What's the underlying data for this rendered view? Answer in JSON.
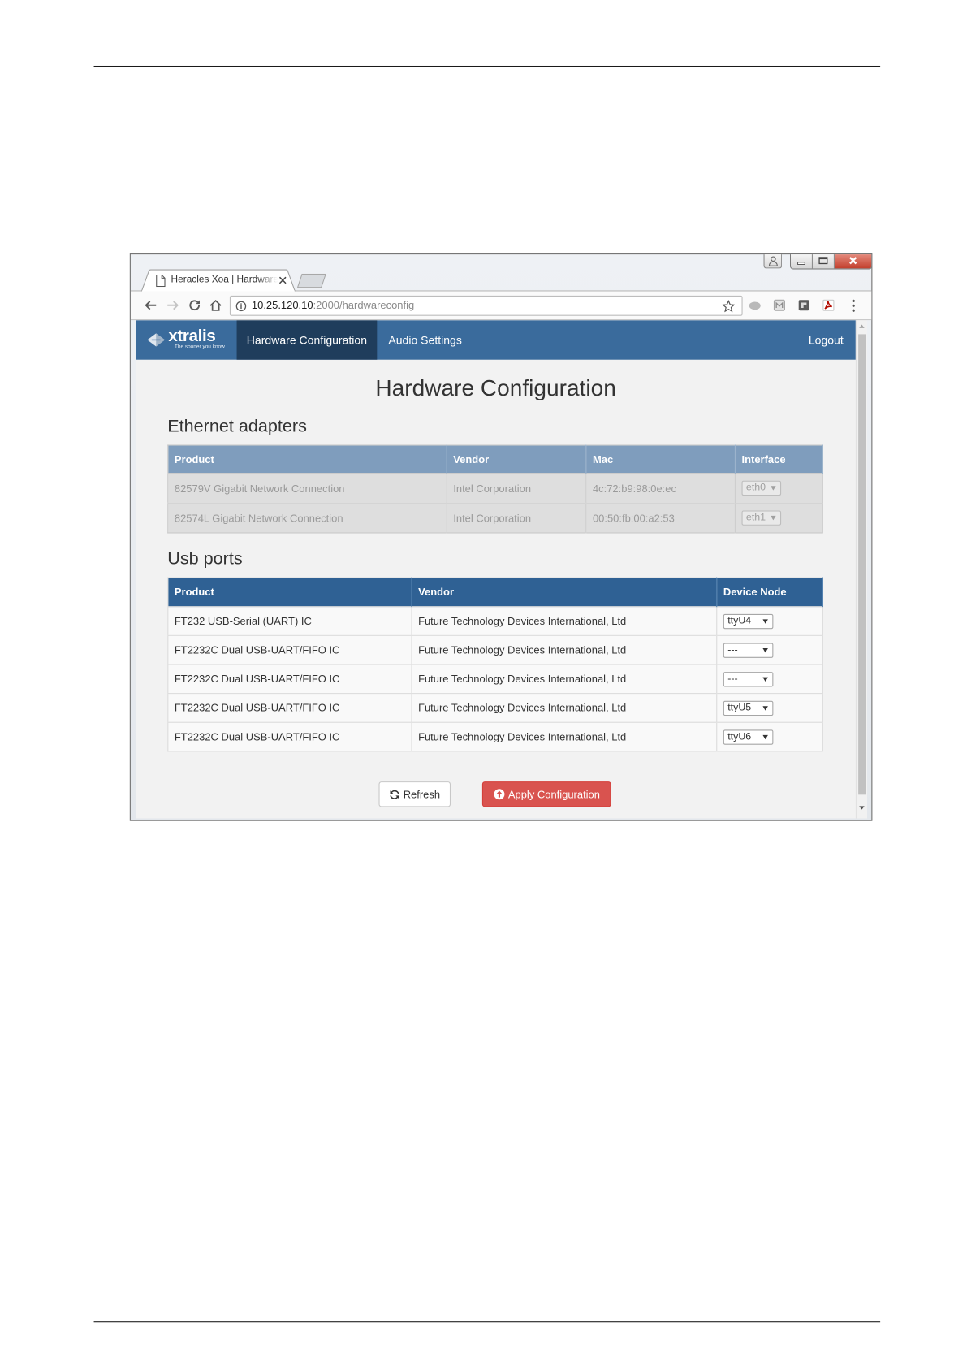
{
  "browser": {
    "tab_title": "Heracles Xoa | Hardware",
    "url_host": "10.25.120.10",
    "url_path": ":2000/hardwareconfig",
    "icons": [
      "user-icon",
      "minimize-icon",
      "maximize-icon",
      "close-icon",
      "page-icon",
      "tab-close-icon",
      "back-arrow-icon",
      "forward-arrow-icon",
      "reload-icon",
      "home-icon",
      "info-icon",
      "star-icon",
      "extension-gray-icon",
      "extension-box-icon",
      "extension-dark-icon",
      "acrobat-pdf-icon",
      "menu-dots-icon"
    ]
  },
  "navbar": {
    "logo_text": "xtralis",
    "logo_tagline": "The sooner you know",
    "items": [
      {
        "label": "Hardware Configuration",
        "active": true
      },
      {
        "label": "Audio Settings",
        "active": false
      }
    ],
    "logout_label": "Logout"
  },
  "page": {
    "title": "Hardware Configuration"
  },
  "ethernet": {
    "heading": "Ethernet adapters",
    "disabled": true,
    "columns": {
      "product": "Product",
      "vendor": "Vendor",
      "mac": "Mac",
      "interface": "Interface"
    },
    "rows": [
      {
        "product": "82579V Gigabit Network Connection",
        "vendor": "Intel Corporation",
        "mac": "4c:72:b9:98:0e:ec",
        "interface": "eth0"
      },
      {
        "product": "82574L Gigabit Network Connection",
        "vendor": "Intel Corporation",
        "mac": "00:50:fb:00:a2:53",
        "interface": "eth1"
      }
    ]
  },
  "usb": {
    "heading": "Usb ports",
    "columns": {
      "product": "Product",
      "vendor": "Vendor",
      "device_node": "Device Node"
    },
    "rows": [
      {
        "product": "FT232 USB-Serial (UART) IC",
        "vendor": "Future Technology Devices International, Ltd",
        "device_node": "ttyU4"
      },
      {
        "product": "FT2232C Dual USB-UART/FIFO IC",
        "vendor": "Future Technology Devices International, Ltd",
        "device_node": "---"
      },
      {
        "product": "FT2232C Dual USB-UART/FIFO IC",
        "vendor": "Future Technology Devices International, Ltd",
        "device_node": "---"
      },
      {
        "product": "FT2232C Dual USB-UART/FIFO IC",
        "vendor": "Future Technology Devices International, Ltd",
        "device_node": "ttyU5"
      },
      {
        "product": "FT2232C Dual USB-UART/FIFO IC",
        "vendor": "Future Technology Devices International, Ltd",
        "device_node": "ttyU6"
      }
    ]
  },
  "actions": {
    "refresh_label": "Refresh",
    "refresh_icon": "refresh-icon",
    "apply_label": "Apply Configuration",
    "apply_icon": "circle-arrow-up-icon"
  },
  "colors": {
    "navbar": "#3a6b9c",
    "navbar_active": "#1f3d5c",
    "usb_header": "#2f6194",
    "ethernet_header_disabled": "#7f9dbd",
    "apply_button": "#d9534f",
    "page_background": "#f2f2f2"
  }
}
